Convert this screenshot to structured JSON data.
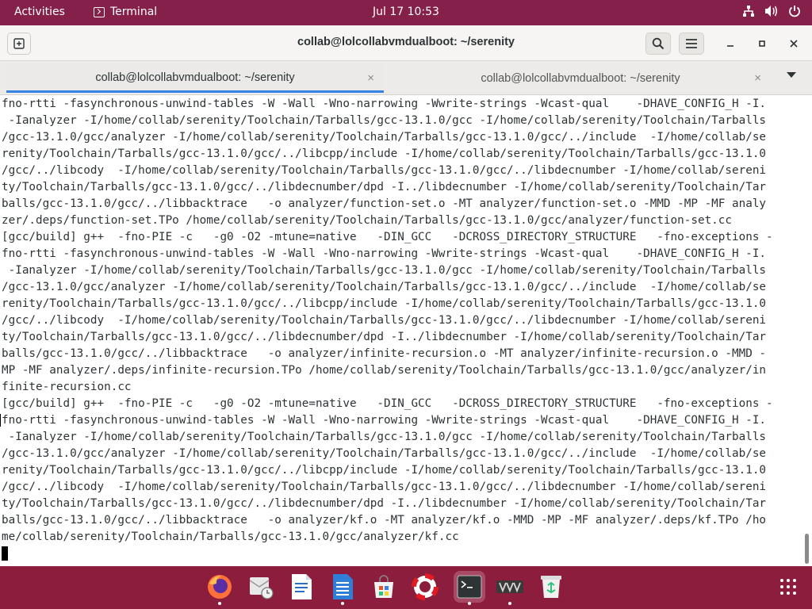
{
  "topbar": {
    "activities": "Activities",
    "app_name": "Terminal",
    "clock": "Jul 17  10:53"
  },
  "window": {
    "title": "collab@lolcollabvmdualboot: ~/serenity"
  },
  "tabs": [
    {
      "label": "collab@lolcollabvmdualboot: ~/serenity",
      "close": "×",
      "active": true
    },
    {
      "label": "collab@lolcollabvmdualboot: ~/serenity",
      "close": "×",
      "active": false
    }
  ],
  "terminal": {
    "lines": [
      "fno-rtti -fasynchronous-unwind-tables -W -Wall -Wno-narrowing -Wwrite-strings -Wcast-qual    -DHAVE_CONFIG_H -I.",
      " -Ianalyzer -I/home/collab/serenity/Toolchain/Tarballs/gcc-13.1.0/gcc -I/home/collab/serenity/Toolchain/Tarballs",
      "/gcc-13.1.0/gcc/analyzer -I/home/collab/serenity/Toolchain/Tarballs/gcc-13.1.0/gcc/../include  -I/home/collab/se",
      "renity/Toolchain/Tarballs/gcc-13.1.0/gcc/../libcpp/include -I/home/collab/serenity/Toolchain/Tarballs/gcc-13.1.0",
      "/gcc/../libcody  -I/home/collab/serenity/Toolchain/Tarballs/gcc-13.1.0/gcc/../libdecnumber -I/home/collab/sereni",
      "ty/Toolchain/Tarballs/gcc-13.1.0/gcc/../libdecnumber/dpd -I../libdecnumber -I/home/collab/serenity/Toolchain/Tar",
      "balls/gcc-13.1.0/gcc/../libbacktrace   -o analyzer/function-set.o -MT analyzer/function-set.o -MMD -MP -MF analy",
      "zer/.deps/function-set.TPo /home/collab/serenity/Toolchain/Tarballs/gcc-13.1.0/gcc/analyzer/function-set.cc",
      "[gcc/build] g++  -fno-PIE -c   -g0 -O2 -mtune=native   -DIN_GCC   -DCROSS_DIRECTORY_STRUCTURE   -fno-exceptions -",
      "fno-rtti -fasynchronous-unwind-tables -W -Wall -Wno-narrowing -Wwrite-strings -Wcast-qual    -DHAVE_CONFIG_H -I.",
      " -Ianalyzer -I/home/collab/serenity/Toolchain/Tarballs/gcc-13.1.0/gcc -I/home/collab/serenity/Toolchain/Tarballs",
      "/gcc-13.1.0/gcc/analyzer -I/home/collab/serenity/Toolchain/Tarballs/gcc-13.1.0/gcc/../include  -I/home/collab/se",
      "renity/Toolchain/Tarballs/gcc-13.1.0/gcc/../libcpp/include -I/home/collab/serenity/Toolchain/Tarballs/gcc-13.1.0",
      "/gcc/../libcody  -I/home/collab/serenity/Toolchain/Tarballs/gcc-13.1.0/gcc/../libdecnumber -I/home/collab/sereni",
      "ty/Toolchain/Tarballs/gcc-13.1.0/gcc/../libdecnumber/dpd -I../libdecnumber -I/home/collab/serenity/Toolchain/Tar",
      "balls/gcc-13.1.0/gcc/../libbacktrace   -o analyzer/infinite-recursion.o -MT analyzer/infinite-recursion.o -MMD -",
      "MP -MF analyzer/.deps/infinite-recursion.TPo /home/collab/serenity/Toolchain/Tarballs/gcc-13.1.0/gcc/analyzer/in",
      "finite-recursion.cc",
      "[gcc/build] g++  -fno-PIE -c   -g0 -O2 -mtune=native   -DIN_GCC   -DCROSS_DIRECTORY_STRUCTURE   -fno-exceptions -",
      "fno-rtti -fasynchronous-unwind-tables -W -Wall -Wno-narrowing -Wwrite-strings -Wcast-qual    -DHAVE_CONFIG_H -I.",
      " -Ianalyzer -I/home/collab/serenity/Toolchain/Tarballs/gcc-13.1.0/gcc -I/home/collab/serenity/Toolchain/Tarballs",
      "/gcc-13.1.0/gcc/analyzer -I/home/collab/serenity/Toolchain/Tarballs/gcc-13.1.0/gcc/../include  -I/home/collab/se",
      "renity/Toolchain/Tarballs/gcc-13.1.0/gcc/../libcpp/include -I/home/collab/serenity/Toolchain/Tarballs/gcc-13.1.0",
      "/gcc/../libcody  -I/home/collab/serenity/Toolchain/Tarballs/gcc-13.1.0/gcc/../libdecnumber -I/home/collab/sereni",
      "ty/Toolchain/Tarballs/gcc-13.1.0/gcc/../libdecnumber/dpd -I../libdecnumber -I/home/collab/serenity/Toolchain/Tar",
      "balls/gcc-13.1.0/gcc/../libbacktrace   -o analyzer/kf.o -MT analyzer/kf.o -MMD -MP -MF analyzer/.deps/kf.TPo /ho",
      "me/collab/serenity/Toolchain/Tarballs/gcc-13.1.0/gcc/analyzer/kf.cc"
    ]
  },
  "dock": {
    "items": [
      {
        "name": "firefox",
        "icon": "firefox-icon",
        "running": true
      },
      {
        "name": "evolution",
        "icon": "mail-clock-icon",
        "running": false
      },
      {
        "name": "writer",
        "icon": "document-icon",
        "running": false
      },
      {
        "name": "calc",
        "icon": "spreadsheet-icon",
        "running": true
      },
      {
        "name": "software",
        "icon": "store-bag-icon",
        "running": false
      },
      {
        "name": "help",
        "icon": "lifebuoy-icon",
        "running": false
      },
      {
        "name": "terminal",
        "icon": "terminal-icon",
        "running": true
      },
      {
        "name": "vm",
        "icon": "vm-icon",
        "running": true
      },
      {
        "name": "trash",
        "icon": "trash-icon",
        "running": false
      }
    ],
    "apps_grid_icon": "apps-grid-icon"
  },
  "colors": {
    "topbar_bg": "#84204a",
    "dock_bg": "#8c1d3d",
    "tab_accent": "#3584e4",
    "terminal_fg": "#2e3436"
  }
}
